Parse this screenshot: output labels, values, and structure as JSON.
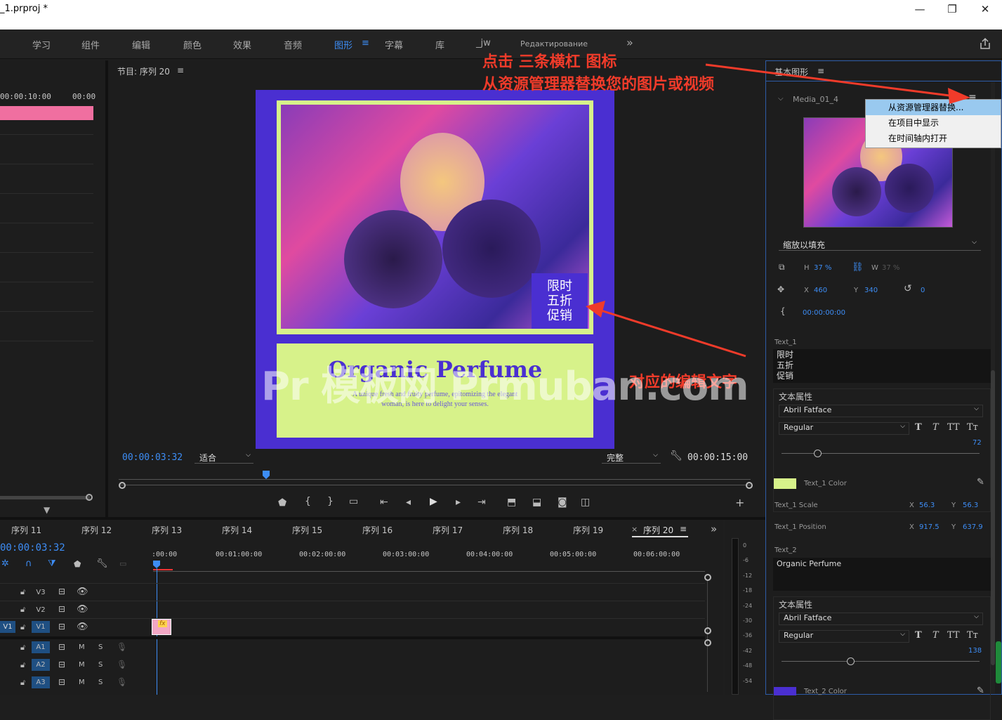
{
  "window": {
    "title": "_1.prproj *",
    "min": "—",
    "max": "❐",
    "close": "✕"
  },
  "workspaces": [
    "学习",
    "组件",
    "编辑",
    "颜色",
    "效果",
    "音频",
    "图形",
    "字幕",
    "库",
    "_jw",
    "Редактирование"
  ],
  "workspace_active": "图形",
  "workspace_more": "»",
  "annotations": {
    "line1": "点击 三条横杠 图标",
    "line2": "从资源管理器替换您的图片或视频",
    "edit_text": "对应的编辑文字"
  },
  "left_panel": {
    "time_a": "00:00:10:00",
    "time_b": "00:00"
  },
  "program": {
    "title": "节目: 序列 20",
    "menu": "≡",
    "timecode": "00:00:03:32",
    "fit": "适合",
    "quality": "完整",
    "duration": "00:00:15:00"
  },
  "poster": {
    "badge_l1": "限时",
    "badge_l2": "五折",
    "badge_l3": "促销",
    "title": "Organic Perfume",
    "subtitle_l1": "A unique fresh and fruity perfume, epitomizing the elegant",
    "subtitle_l2": "woman, is here to delight your senses."
  },
  "watermark": "Pr 模板网 Prmuban.com",
  "essential": {
    "title": "基本图形",
    "menu": "≡",
    "media_name": "Media_01_4",
    "hamburger": "≡",
    "context_menu": [
      "从资源管理器替换...",
      "在项目中显示",
      "在时间轴内打开"
    ],
    "scale_mode": "缩放以填充",
    "h_label": "H",
    "h_val": "37 %",
    "w_label": "W",
    "w_val": "37 %",
    "x_label": "X",
    "x_val": "460",
    "y_label": "Y",
    "y_val": "340",
    "rot_val": "0",
    "time_val": "00:00:00:00",
    "text1_label": "Text_1",
    "text1_l1": "限时",
    "text1_l2": "五折",
    "text1_l3": "促销",
    "text_props": "文本属性",
    "font": "Abril Fatface",
    "style": "Regular",
    "size1": "72",
    "text1_color": "Text_1 Color",
    "text1_scale": "Text_1 Scale",
    "scale_x": "56.3",
    "scale_y": "56.3",
    "text1_pos": "Text_1 Position",
    "pos_x": "917.5",
    "pos_y": "637.9",
    "text2_label": "Text_2",
    "text2_val": "Organic Perfume",
    "text_props2": "文本属性",
    "font2": "Abril Fatface",
    "style2": "Regular",
    "size2": "138",
    "text2_color": "Text_2 Color",
    "fmt": [
      "T",
      "T",
      "TT",
      "Tт"
    ],
    "colors": {
      "text1": "#d7f28a",
      "text2": "#4a2fd1"
    }
  },
  "timeline": {
    "tabs": [
      "序列 11",
      "序列 12",
      "序列 13",
      "序列 14",
      "序列 15",
      "序列 16",
      "序列 17",
      "序列 18",
      "序列 19",
      "序列 20"
    ],
    "active_tab": "序列 20",
    "timecode": "00:00:03:32",
    "ruler": [
      ":00:00",
      "00:01:00:00",
      "00:02:00:00",
      "00:03:00:00",
      "00:04:00:00",
      "00:05:00:00",
      "00:06:00:00"
    ],
    "video_tracks": [
      "V3",
      "V2",
      "V1"
    ],
    "audio_tracks": [
      "A1",
      "A2",
      "A3"
    ],
    "src": "V1",
    "m": "M",
    "s": "S",
    "clip_fx": "fx"
  },
  "meter": [
    "0",
    "-6",
    "-12",
    "-18",
    "-24",
    "-30",
    "-36",
    "-42",
    "-48",
    "-54"
  ]
}
